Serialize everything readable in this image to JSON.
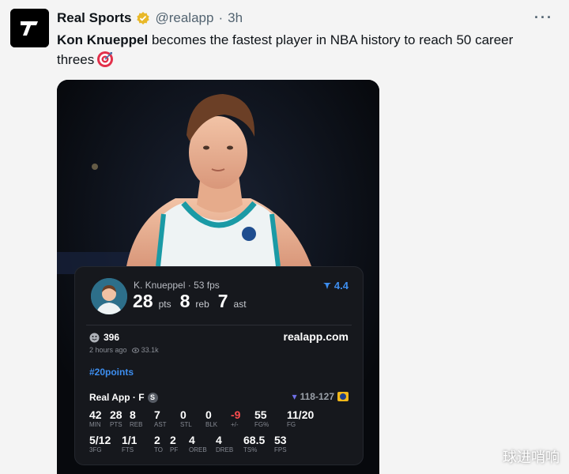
{
  "header": {
    "account_name": "Real Sports",
    "handle": "@realapp",
    "separator": "·",
    "time": "3h",
    "more_label": "···"
  },
  "tweet": {
    "player_name": "Kon Knueppel",
    "text_rest": " becomes the fastest player in NBA history to reach 50 career threes",
    "emoji_icon": "direct-hit-target-icon"
  },
  "card": {
    "player": "K. Knueppel",
    "sep": "·",
    "fps": "53 fps",
    "stats": [
      {
        "value": "28",
        "unit": "pts"
      },
      {
        "value": "8",
        "unit": "reb"
      },
      {
        "value": "7",
        "unit": "ast"
      }
    ],
    "rating": "4.4",
    "likes": "396",
    "link": "realapp.com",
    "posted": "2 hours ago",
    "views": "33.1k",
    "hashtag": "#20points",
    "source": "Real App · F",
    "source_badge": "S",
    "score": "118-127",
    "row1": [
      {
        "val": "42",
        "lbl": "MIN"
      },
      {
        "val": "28",
        "lbl": "PTS"
      },
      {
        "val": "8",
        "lbl": "REB"
      },
      {
        "val": "7",
        "lbl": "AST"
      },
      {
        "val": "0",
        "lbl": "STL"
      },
      {
        "val": "0",
        "lbl": "BLK"
      },
      {
        "val": "-9",
        "lbl": "+/-"
      },
      {
        "val": "55",
        "lbl": "FG%"
      },
      {
        "val": "11/20",
        "lbl": "FG"
      }
    ],
    "row2": [
      {
        "val": "5/12",
        "lbl": "3FG"
      },
      {
        "val": "1/1",
        "lbl": "FTS"
      },
      {
        "val": "2",
        "lbl": "TO"
      },
      {
        "val": "2",
        "lbl": "PF"
      },
      {
        "val": "4",
        "lbl": "OREB"
      },
      {
        "val": "4",
        "lbl": "DREB"
      },
      {
        "val": "68.5",
        "lbl": "TS%"
      },
      {
        "val": "53",
        "lbl": "FPS"
      }
    ]
  },
  "watermark": "球进哨响",
  "colors": {
    "accent_blue": "#3d8ef0",
    "negative_red": "#ff4d4f",
    "verified_gold": "#e8b829"
  }
}
